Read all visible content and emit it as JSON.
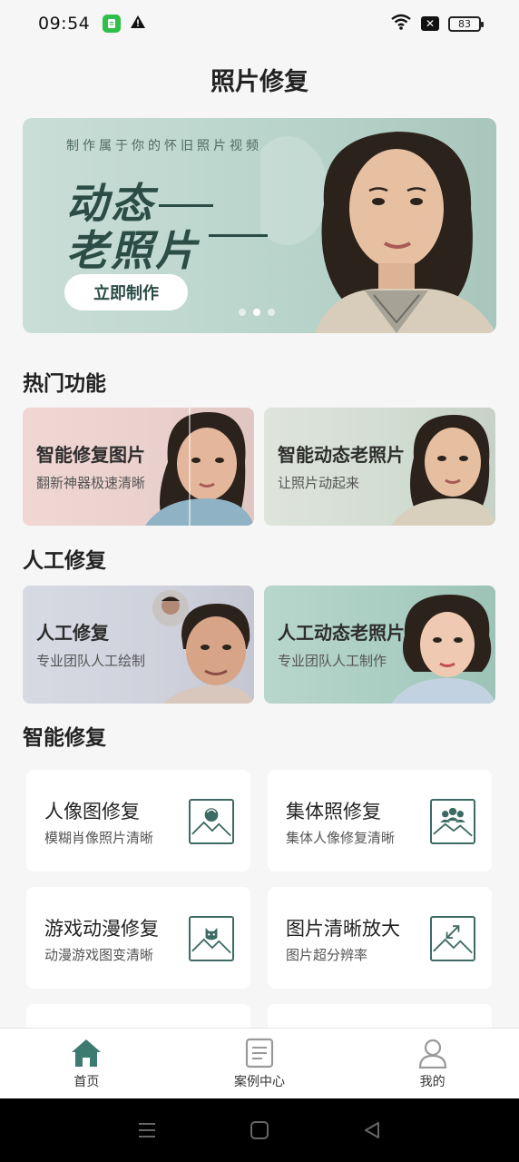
{
  "status_bar": {
    "time": "09:54",
    "battery": "83"
  },
  "header": {
    "title": "照片修复"
  },
  "banner": {
    "subtitle": "制作属于你的怀旧照片视频",
    "headline_line1": "动态",
    "headline_line2": "老照片",
    "button_label": "立即制作",
    "active_slide": 2,
    "slide_count": 3
  },
  "hot_features": {
    "title": "热门功能",
    "items": [
      {
        "title": "智能修复图片",
        "subtitle": "翻新神器极速清晰"
      },
      {
        "title": "智能动态老照片",
        "subtitle": "让照片动起来"
      }
    ]
  },
  "manual_repair": {
    "title": "人工修复",
    "items": [
      {
        "title": "人工修复",
        "subtitle": "专业团队人工绘制"
      },
      {
        "title": "人工动态老照片",
        "subtitle": "专业团队人工制作"
      }
    ]
  },
  "smart_repair": {
    "title": "智能修复",
    "items": [
      {
        "title": "人像图修复",
        "subtitle": "模糊肖像照片清晰",
        "icon": "portrait-photo-icon"
      },
      {
        "title": "集体照修复",
        "subtitle": "集体人像修复清晰",
        "icon": "group-photo-icon"
      },
      {
        "title": "游戏动漫修复",
        "subtitle": "动漫游戏图变清晰",
        "icon": "anime-photo-icon"
      },
      {
        "title": "图片清晰放大",
        "subtitle": "图片超分辨率",
        "icon": "enlarge-photo-icon"
      }
    ]
  },
  "bottom_nav": {
    "items": [
      {
        "label": "首页",
        "icon": "home-icon",
        "active": true
      },
      {
        "label": "案例中心",
        "icon": "document-icon",
        "active": false
      },
      {
        "label": "我的",
        "icon": "user-icon",
        "active": false
      }
    ]
  },
  "colors": {
    "accent": "#3d7a70",
    "background": "#f6f6f6"
  }
}
